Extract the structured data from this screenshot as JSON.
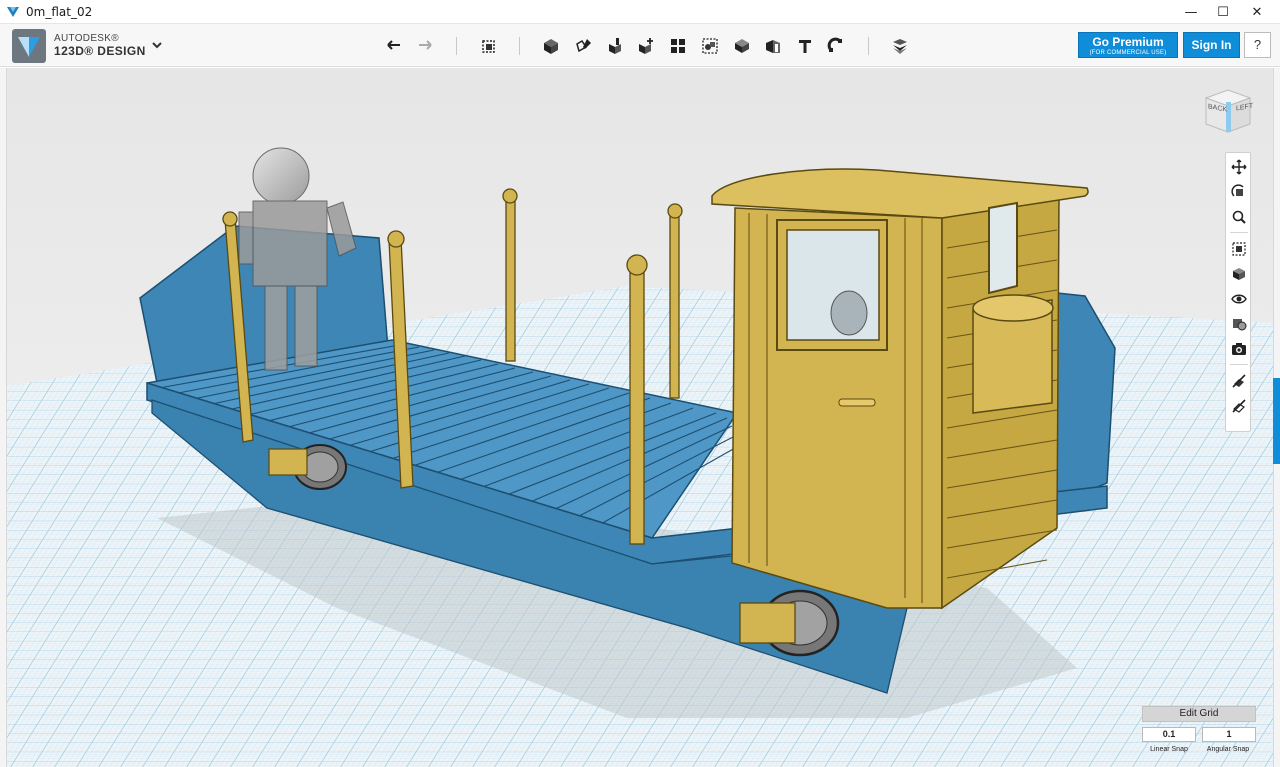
{
  "window": {
    "title": "0m_flat_02",
    "minimize": "—",
    "maximize": "☐",
    "close": "✕"
  },
  "app": {
    "brand_line1": "AUTODESK®",
    "brand_line2": "123D® DESIGN"
  },
  "toolbar": {
    "tools": [
      "undo-icon",
      "redo-icon",
      "transform-icon",
      "primitives-icon",
      "sketch-icon",
      "construct-icon",
      "modify-icon",
      "pattern-icon",
      "grouping-icon",
      "combine-icon",
      "measure-icon",
      "text-icon",
      "snap-icon",
      "material-icon"
    ],
    "premium_label": "Go Premium",
    "premium_sub": "(FOR COMMERCIAL USE)",
    "signin_label": "Sign In",
    "help_label": "?"
  },
  "viewcube": {
    "back": "BACK",
    "left": "LEFT"
  },
  "navbar": {
    "tools": [
      "pan-icon",
      "orbit-icon",
      "zoom-icon",
      "fit-icon",
      "view-options-icon",
      "visibility-icon",
      "materials-icon",
      "screenshot-icon",
      "hide-icon",
      "visibility-toggle-icon"
    ]
  },
  "snap": {
    "header": "Edit Grid",
    "linear_value": "0.1",
    "angular_value": "1",
    "linear_label": "Linear Snap",
    "angular_label": "Angular Snap"
  },
  "colors": {
    "accent": "#0f8dd8",
    "model_blue": "#3d86b5",
    "model_gold": "#d2b450",
    "figure_gray": "#a8a8a8",
    "grid_line": "#9ec8e0"
  }
}
